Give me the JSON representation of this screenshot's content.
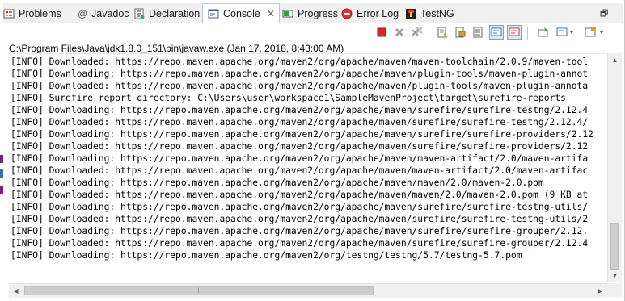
{
  "tabs": [
    {
      "label": "Problems",
      "icon": "problems-icon"
    },
    {
      "label": "Javadoc",
      "icon": "javadoc-at-icon",
      "glyph": "@"
    },
    {
      "label": "Declaration",
      "icon": "declaration-icon"
    },
    {
      "label": "Console",
      "icon": "console-icon",
      "close": "✕"
    },
    {
      "label": "Progress",
      "icon": "progress-icon"
    },
    {
      "label": "Error Log",
      "icon": "error-log-icon"
    },
    {
      "label": "TestNG",
      "icon": "testng-icon"
    }
  ],
  "window": {
    "restore_glyph": "🗗"
  },
  "console": {
    "header": "C:\\Program Files\\Java\\jdk1.8.0_151\\bin\\javaw.exe (Jan 17, 2018, 8:43:00 AM)",
    "lines": [
      "[INFO] Downloaded: https://repo.maven.apache.org/maven2/org/apache/maven/maven-toolchain/2.0.9/maven-tool",
      "[INFO] Downloading: https://repo.maven.apache.org/maven2/org/apache/maven/plugin-tools/maven-plugin-annot",
      "[INFO] Downloaded: https://repo.maven.apache.org/maven2/org/apache/maven/plugin-tools/maven-plugin-annota",
      "[INFO] Surefire report directory: C:\\Users\\user\\workspace1\\SampleMavenProject\\target\\surefire-reports",
      "[INFO] Downloading: https://repo.maven.apache.org/maven2/org/apache/maven/surefire/surefire-testng/2.12.4",
      "[INFO] Downloaded: https://repo.maven.apache.org/maven2/org/apache/maven/surefire/surefire-testng/2.12.4/",
      "[INFO] Downloading: https://repo.maven.apache.org/maven2/org/apache/maven/surefire/surefire-providers/2.12",
      "[INFO] Downloaded: https://repo.maven.apache.org/maven2/org/apache/maven/surefire/surefire-providers/2.12",
      "[INFO] Downloading: https://repo.maven.apache.org/maven2/org/apache/maven/maven-artifact/2.0/maven-artifa",
      "[INFO] Downloaded: https://repo.maven.apache.org/maven2/org/apache/maven/maven-artifact/2.0/maven-artifac",
      "[INFO] Downloading: https://repo.maven.apache.org/maven2/org/apache/maven/maven/2.0/maven-2.0.pom",
      "[INFO] Downloaded: https://repo.maven.apache.org/maven2/org/apache/maven/maven/2.0/maven-2.0.pom (9 KB at",
      "[INFO] Downloading: https://repo.maven.apache.org/maven2/org/apache/maven/surefire/surefire-testng-utils/",
      "[INFO] Downloaded: https://repo.maven.apache.org/maven2/org/apache/maven/surefire/surefire-testng-utils/2",
      "[INFO] Downloading: https://repo.maven.apache.org/maven2/org/apache/maven/surefire/surefire-grouper/2.12.",
      "[INFO] Downloaded: https://repo.maven.apache.org/maven2/org/apache/maven/surefire/surefire-grouper/2.12.4",
      "[INFO] Downloading: https://repo.maven.apache.org/maven2/org/testng/testng/5.7/testng-5.7.pom"
    ]
  },
  "toolbar": {
    "buttons": [
      {
        "name": "terminate-icon",
        "color": "#d9262b"
      },
      {
        "name": "remove-launch-icon",
        "color": "#9a9a9a"
      },
      {
        "name": "remove-all-terminated-icon",
        "color": "#9a9a9a"
      },
      {
        "name": "clear-console-icon",
        "color": "#6b6b6b"
      },
      {
        "name": "scroll-lock-icon",
        "color": "#c9a23a"
      },
      {
        "name": "word-wrap-icon",
        "color": "#6b6b6b"
      },
      {
        "name": "show-console-on-stdout-icon",
        "color": "#3b6fb6"
      },
      {
        "name": "show-console-on-stderr-icon",
        "color": "#c33"
      },
      {
        "name": "pin-console-icon",
        "color": "#2e8b57"
      },
      {
        "name": "display-selected-console-icon",
        "color": "#4a6fa5"
      },
      {
        "name": "open-console-icon",
        "color": "#d8a21c"
      }
    ]
  },
  "scrollbars": {
    "up": "▲",
    "down": "▼",
    "left": "◀",
    "right": "▶",
    "grip_v": "≡",
    "grip_h": "|||"
  }
}
